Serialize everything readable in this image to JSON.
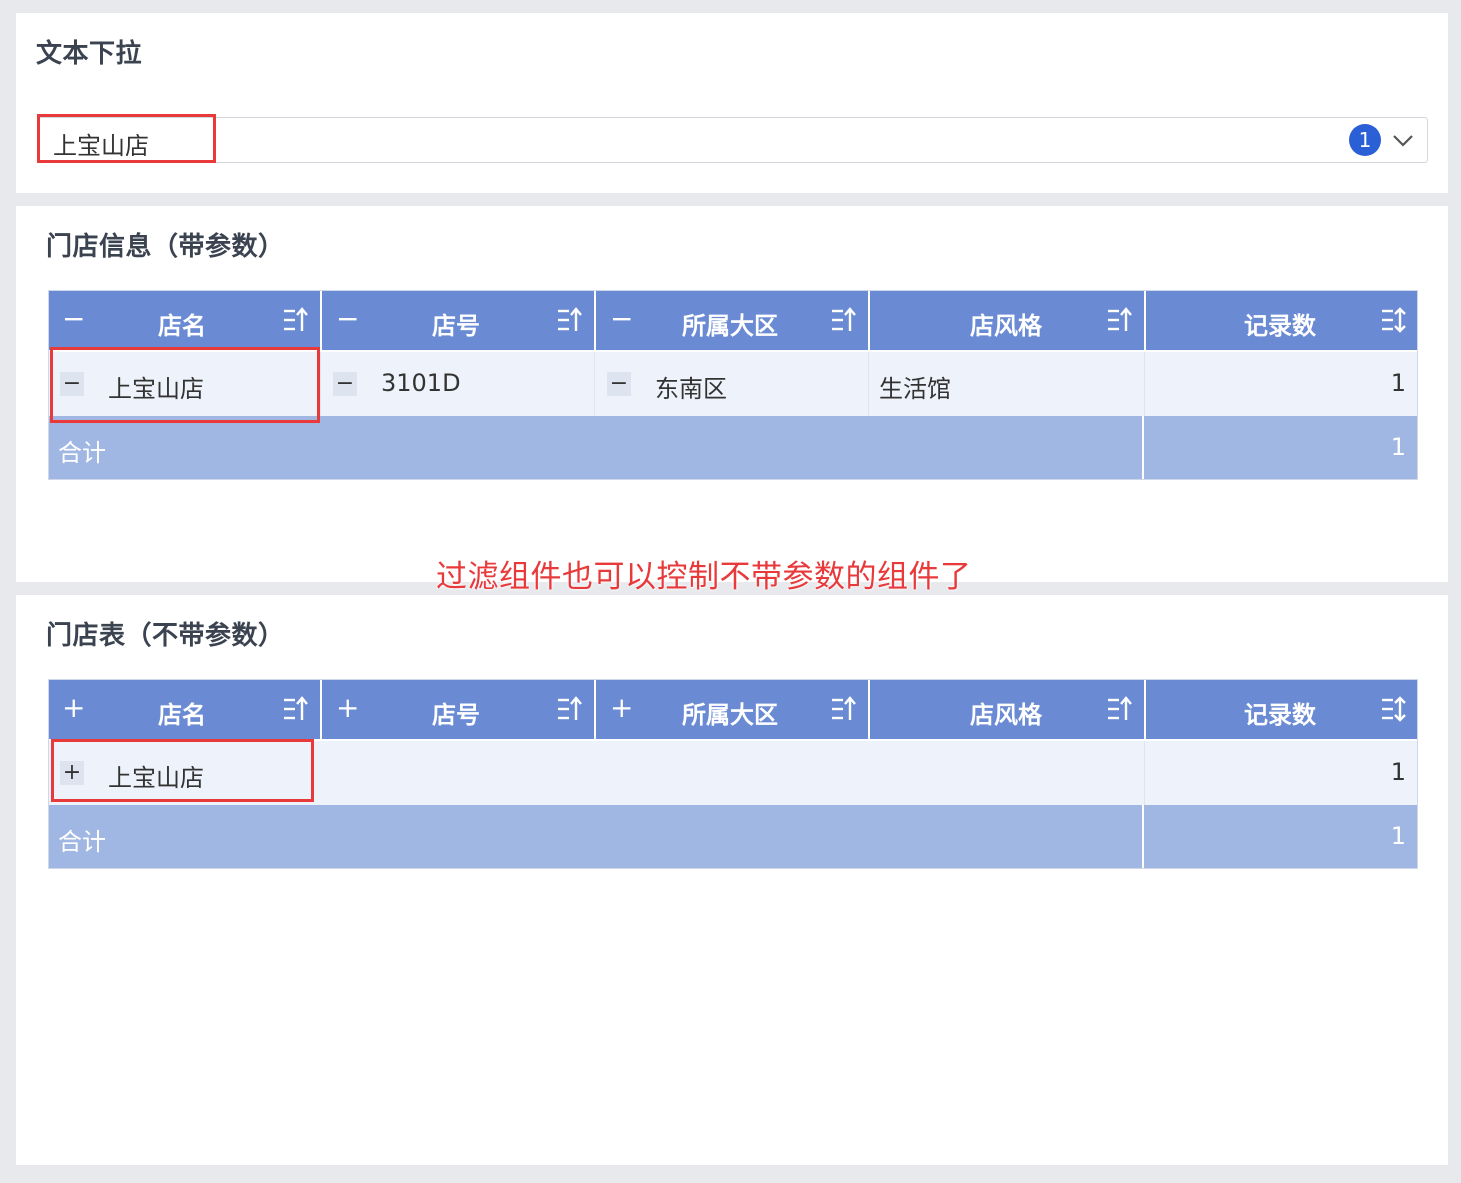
{
  "filter": {
    "title": "文本下拉",
    "selected_value": "上宝山店",
    "selected_count": "1"
  },
  "table1": {
    "title": "门店信息（带参数）",
    "headers": [
      {
        "toggle": "−",
        "label": "店名"
      },
      {
        "toggle": "−",
        "label": "店号"
      },
      {
        "toggle": "−",
        "label": "所属大区"
      },
      {
        "toggle": "",
        "label": "店风格"
      },
      {
        "toggle": "",
        "label": "记录数"
      }
    ],
    "row": {
      "store_name": "上宝山店",
      "store_no": "3101D",
      "region": "东南区",
      "style": "生活馆",
      "count": "1",
      "toggle": "−"
    },
    "total": {
      "label": "合计",
      "value": "1"
    }
  },
  "annotation": "过滤组件也可以控制不带参数的组件了",
  "table2": {
    "title": "门店表（不带参数）",
    "headers": [
      {
        "toggle": "+",
        "label": "店名"
      },
      {
        "toggle": "+",
        "label": "店号"
      },
      {
        "toggle": "+",
        "label": "所属大区"
      },
      {
        "toggle": "",
        "label": "店风格"
      },
      {
        "toggle": "",
        "label": "记录数"
      }
    ],
    "row": {
      "store_name": "上宝山店",
      "count": "1",
      "toggle": "+"
    },
    "total": {
      "label": "合计",
      "value": "1"
    }
  },
  "colors": {
    "header_bg": "#6a8bd4",
    "total_bg": "#a0b6e3",
    "row_bg": "#eef2fa",
    "highlight": "#e8393b",
    "badge": "#2a5fd6"
  }
}
